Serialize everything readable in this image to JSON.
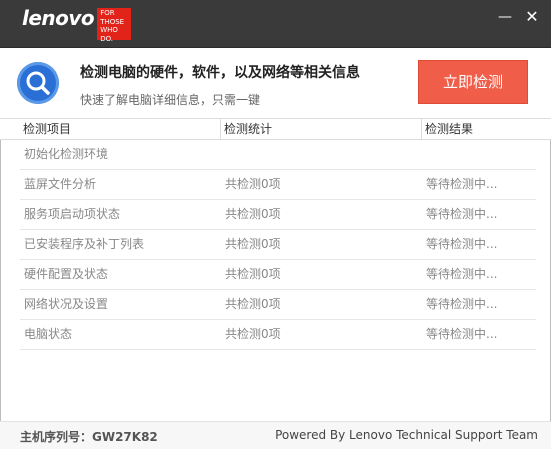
{
  "titlebar": {
    "logo_word": "lenovo",
    "logo_tag": [
      "FOR",
      "THOSE",
      "WHO DO."
    ],
    "minimize_icon": "minimize-icon",
    "close_icon": "close-icon"
  },
  "header": {
    "icon": "search-icon",
    "headline": "检测电脑的硬件，软件，以及网络等相关信息",
    "subline": "快速了解电脑详细信息，只需一键",
    "start_button": "立即检测",
    "accent_color": "#f05e4a",
    "icon_color": "#2a6fd6"
  },
  "table": {
    "columns": [
      "检测项目",
      "检测统计",
      "检测结果"
    ],
    "rows": [
      {
        "item": "初始化检测环境",
        "count": "",
        "result": ""
      },
      {
        "item": "蓝屏文件分析",
        "count": "共检测0项",
        "result": "等待检测中..."
      },
      {
        "item": "服务项启动项状态",
        "count": "共检测0项",
        "result": "等待检测中..."
      },
      {
        "item": "已安装程序及补丁列表",
        "count": "共检测0项",
        "result": "等待检测中..."
      },
      {
        "item": "硬件配置及状态",
        "count": "共检测0项",
        "result": "等待检测中..."
      },
      {
        "item": "网络状况及设置",
        "count": "共检测0项",
        "result": "等待检测中..."
      },
      {
        "item": "电脑状态",
        "count": "共检测0项",
        "result": "等待检测中..."
      }
    ]
  },
  "footer": {
    "serial": "主机序列号：GW27K82",
    "powered_by": "Powered By Lenovo Technical Support Team"
  }
}
